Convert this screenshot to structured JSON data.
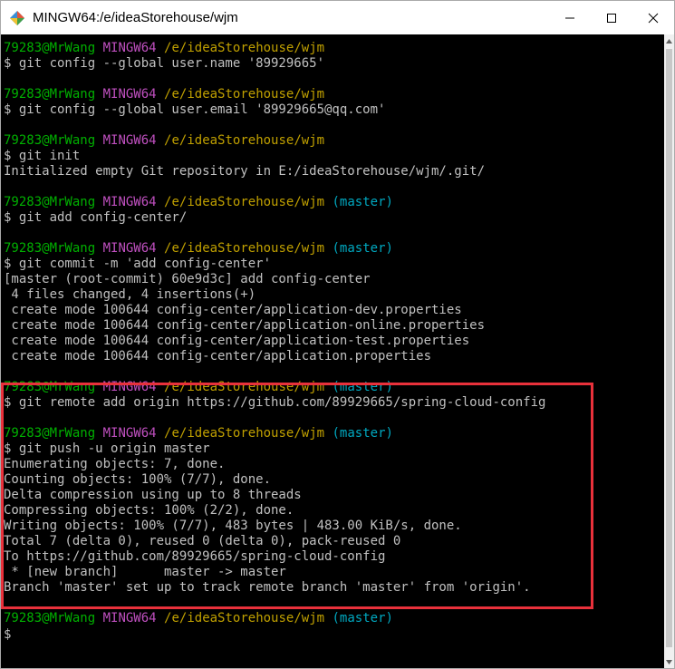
{
  "window": {
    "title": "MINGW64:/e/ideaStorehouse/wjm",
    "app_icon": "git-bash-icon",
    "controls": [
      "minimize-icon",
      "maximize-icon",
      "close-icon"
    ]
  },
  "terminal": {
    "prompt_user": "79283@MrWang",
    "prompt_env": "MINGW64",
    "colors": {
      "background": "#000000",
      "text": "#c0c0c0",
      "user": "#00b000",
      "env": "#c050c0",
      "path": "#c0a000",
      "branch": "#00a8c0",
      "highlight": "#e8313b"
    },
    "lines": [
      {
        "type": "prompt",
        "path": "/e/ideaStorehouse/wjm",
        "branch": ""
      },
      {
        "type": "text",
        "text": "$ git config --global user.name '89929665'"
      },
      {
        "type": "blank",
        "text": ""
      },
      {
        "type": "prompt",
        "path": "/e/ideaStorehouse/wjm",
        "branch": ""
      },
      {
        "type": "text",
        "text": "$ git config --global user.email '89929665@qq.com'"
      },
      {
        "type": "blank",
        "text": ""
      },
      {
        "type": "prompt",
        "path": "/e/ideaStorehouse/wjm",
        "branch": ""
      },
      {
        "type": "text",
        "text": "$ git init"
      },
      {
        "type": "text",
        "text": "Initialized empty Git repository in E:/ideaStorehouse/wjm/.git/"
      },
      {
        "type": "blank",
        "text": ""
      },
      {
        "type": "prompt",
        "path": "/e/ideaStorehouse/wjm",
        "branch": "(master)"
      },
      {
        "type": "text",
        "text": "$ git add config-center/"
      },
      {
        "type": "blank",
        "text": ""
      },
      {
        "type": "prompt",
        "path": "/e/ideaStorehouse/wjm",
        "branch": "(master)"
      },
      {
        "type": "text",
        "text": "$ git commit -m 'add config-center'"
      },
      {
        "type": "text",
        "text": "[master (root-commit) 60e9d3c] add config-center"
      },
      {
        "type": "text",
        "text": " 4 files changed, 4 insertions(+)"
      },
      {
        "type": "text",
        "text": " create mode 100644 config-center/application-dev.properties"
      },
      {
        "type": "text",
        "text": " create mode 100644 config-center/application-online.properties"
      },
      {
        "type": "text",
        "text": " create mode 100644 config-center/application-test.properties"
      },
      {
        "type": "text",
        "text": " create mode 100644 config-center/application.properties"
      },
      {
        "type": "blank",
        "text": ""
      },
      {
        "type": "prompt",
        "path": "/e/ideaStorehouse/wjm",
        "branch": "(master)"
      },
      {
        "type": "text",
        "text": "$ git remote add origin https://github.com/89929665/spring-cloud-config"
      },
      {
        "type": "blank",
        "text": ""
      },
      {
        "type": "prompt",
        "path": "/e/ideaStorehouse/wjm",
        "branch": "(master)"
      },
      {
        "type": "text",
        "text": "$ git push -u origin master"
      },
      {
        "type": "text",
        "text": "Enumerating objects: 7, done."
      },
      {
        "type": "text",
        "text": "Counting objects: 100% (7/7), done."
      },
      {
        "type": "text",
        "text": "Delta compression using up to 8 threads"
      },
      {
        "type": "text",
        "text": "Compressing objects: 100% (2/2), done."
      },
      {
        "type": "text",
        "text": "Writing objects: 100% (7/7), 483 bytes | 483.00 KiB/s, done."
      },
      {
        "type": "text",
        "text": "Total 7 (delta 0), reused 0 (delta 0), pack-reused 0"
      },
      {
        "type": "text",
        "text": "To https://github.com/89929665/spring-cloud-config"
      },
      {
        "type": "text",
        "text": " * [new branch]      master -> master"
      },
      {
        "type": "text",
        "text": "Branch 'master' set up to track remote branch 'master' from 'origin'."
      },
      {
        "type": "blank",
        "text": ""
      },
      {
        "type": "prompt",
        "path": "/e/ideaStorehouse/wjm",
        "branch": "(master)"
      },
      {
        "type": "cursor",
        "text": "$"
      }
    ]
  }
}
